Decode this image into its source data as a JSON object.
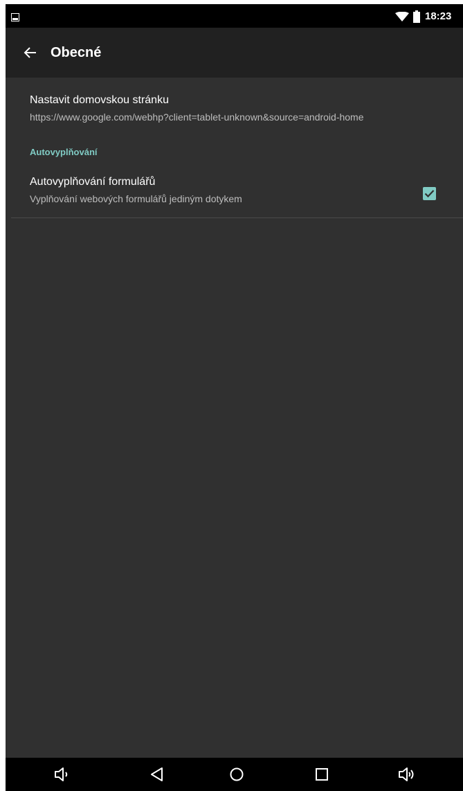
{
  "status_bar": {
    "time": "18:23",
    "icons": [
      "gallery-notification-icon",
      "wifi-icon",
      "battery-icon"
    ]
  },
  "toolbar": {
    "title": "Obecné",
    "back_icon": "arrow-back-icon"
  },
  "preferences": {
    "homepage": {
      "title": "Nastavit domovskou stránku",
      "summary": "https://www.google.com/webhp?client=tablet-unknown&source=android-home"
    },
    "autofill_category": "Autovyplňování",
    "autofill": {
      "title": "Autovyplňování formulářů",
      "summary": "Vyplňování webových formulářů jediným dotykem",
      "checked": true
    }
  },
  "nav_bar": {
    "buttons": [
      "volume-down-icon",
      "back-icon",
      "home-icon",
      "recents-icon",
      "volume-up-icon"
    ]
  },
  "colors": {
    "background": "#303030",
    "toolbar": "#212121",
    "accent": "#80cbc4",
    "status_bar": "#000000"
  }
}
